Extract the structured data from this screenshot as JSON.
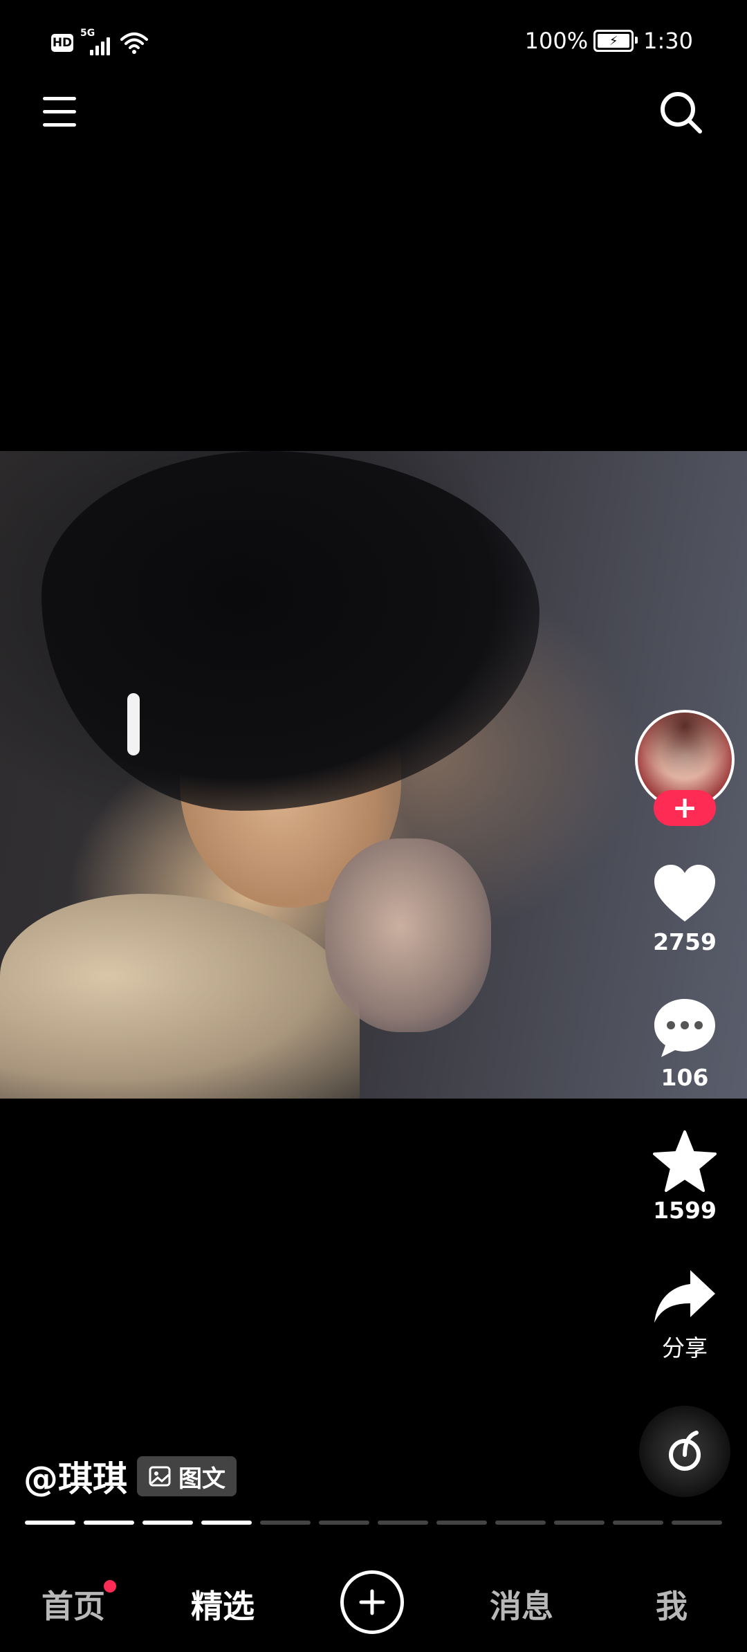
{
  "status_bar": {
    "hd_label": "HD",
    "network_type": "5G",
    "battery_percent": "100%",
    "time": "1:30"
  },
  "top_bar": {
    "menu_icon": "menu-icon",
    "search_icon": "search-icon"
  },
  "actions": {
    "like_count": "2759",
    "comment_count": "106",
    "favorite_count": "1599",
    "share_label": "分享",
    "follow_symbol": "+"
  },
  "post": {
    "author": "@琪琪",
    "tag_label": "图文",
    "image_count": 12,
    "current_image": 4
  },
  "bottom_nav": {
    "home": "首页",
    "featured": "精选",
    "messages": "消息",
    "me": "我",
    "home_has_badge": true,
    "active": "精选"
  },
  "colors": {
    "accent": "#fe2c55",
    "background": "#000000"
  }
}
